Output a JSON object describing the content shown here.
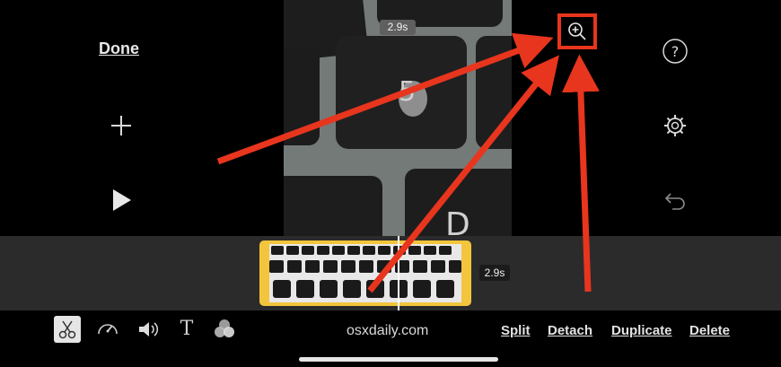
{
  "header": {
    "done_label": "Done"
  },
  "preview": {
    "duration": "2.9s"
  },
  "timeline": {
    "clip_duration": "2.9s"
  },
  "toolbar": {
    "tools": [
      "scissors-icon",
      "speed-icon",
      "volume-icon",
      "title-icon",
      "filters-icon"
    ],
    "title_glyph": "T",
    "actions": {
      "split": "Split",
      "detach": "Detach",
      "duplicate": "Duplicate",
      "delete": "Delete"
    }
  },
  "watermark": "osxdaily.com",
  "colors": {
    "annotation_red": "#e8351e",
    "clip_border": "#f2c53d",
    "timeline_bg": "#2b2b2b"
  }
}
